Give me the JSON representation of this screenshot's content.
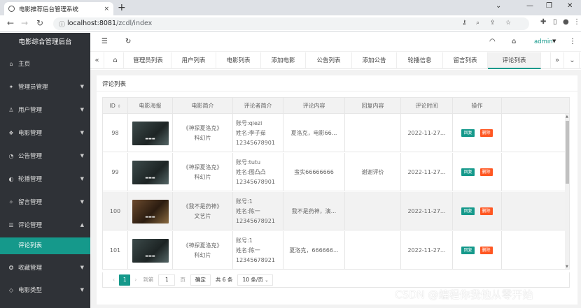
{
  "browser": {
    "tab_title": "电影推荐后台管理系统",
    "tab_close": "×",
    "new_tab": "+",
    "url_host": "localhost:8081",
    "url_path": "/zcdl/index"
  },
  "sidebar": {
    "title": "电影综合管理后台",
    "items": [
      {
        "label": "主页",
        "icon": "home-icon",
        "glyph": "⌂"
      },
      {
        "label": "管理员管理",
        "icon": "admin-icon",
        "glyph": "✦"
      },
      {
        "label": "用户管理",
        "icon": "user-icon",
        "glyph": "♙"
      },
      {
        "label": "电影管理",
        "icon": "film-icon",
        "glyph": "❖"
      },
      {
        "label": "公告管理",
        "icon": "notice-icon",
        "glyph": "◔"
      },
      {
        "label": "轮播管理",
        "icon": "carousel-icon",
        "glyph": "◐"
      },
      {
        "label": "留言管理",
        "icon": "message-icon",
        "glyph": "✧"
      },
      {
        "label": "评论管理",
        "icon": "comment-icon",
        "glyph": "☰"
      },
      {
        "label": "收藏管理",
        "icon": "collect-icon",
        "glyph": "✪"
      },
      {
        "label": "电影类型",
        "icon": "type-icon",
        "glyph": "◇"
      }
    ],
    "sub_item": "评论列表"
  },
  "header": {
    "user": "admin"
  },
  "page_tabs": [
    "管理员列表",
    "用户列表",
    "电影列表",
    "添加电影",
    "公告列表",
    "添加公告",
    "轮播信息",
    "留言列表",
    "评论列表"
  ],
  "card": {
    "title": "评论列表"
  },
  "table": {
    "columns": [
      "ID",
      "电影海报",
      "电影简介",
      "评论者简介",
      "评论内容",
      "回复内容",
      "评论时间",
      "操作"
    ],
    "rows": [
      {
        "id": "98",
        "intro": [
          "《神探夏洛克》",
          "科幻片"
        ],
        "commenter": [
          "账号:qiezi",
          "姓名:李子茹",
          "12345678901"
        ],
        "content": "夏洛克，电影66...",
        "reply": "",
        "time": "2022-11-27...",
        "poster": "poster-dark"
      },
      {
        "id": "99",
        "intro": [
          "《神探夏洛克》",
          "科幻片"
        ],
        "commenter": [
          "账号:tutu",
          "姓名:图凸凸",
          "12345678901"
        ],
        "content": "蛮实66666666",
        "reply": "谢谢评价",
        "time": "2022-11-27...",
        "poster": "poster-dark"
      },
      {
        "id": "100",
        "intro": [
          "《我不是药神》",
          "文艺片"
        ],
        "commenter": [
          "账号:1",
          "姓名:陈一",
          "12345678921"
        ],
        "content": "我不是药神，演...",
        "reply": "",
        "time": "2022-11-27...",
        "poster": "poster-warm"
      },
      {
        "id": "101",
        "intro": [
          "《神探夏洛克》",
          "科幻片"
        ],
        "commenter": [
          "账号:1",
          "姓名:陈一",
          "12345678921"
        ],
        "content": "夏洛克，666666...",
        "reply": "",
        "time": "2022-11-27...",
        "poster": "poster-dark"
      }
    ],
    "reply_btn": "回复",
    "delete_btn": "删除"
  },
  "pager": {
    "current": "1",
    "goto_label": "到第",
    "goto_value": "1",
    "page_unit": "页",
    "confirm": "确定",
    "total": "共 6 条",
    "per_page": "10 条/页"
  },
  "watermark": "CSDN @编程你我他从零开始",
  "colors": {
    "accent": "#15998b",
    "delete": "#ff5722",
    "sidebar": "#2f3237"
  }
}
